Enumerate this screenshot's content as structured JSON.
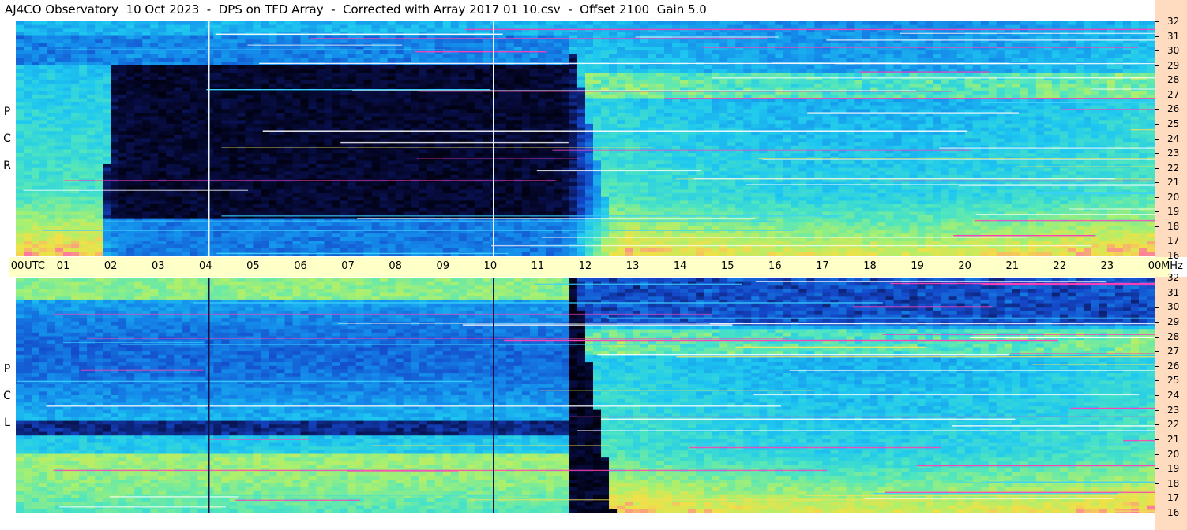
{
  "title": "AJ4CO Observatory  10 Oct 2023  -  DPS on TFD Array  -  Corrected with Array 2017 01 10.csv  -  Offset 2100  Gain 5.0",
  "chart_data": {
    "type": "heatmap",
    "title": "AJ4CO Observatory  10 Oct 2023  -  DPS on TFD Array  -  Corrected with Array 2017 01 10.csv  -  Offset 2100  Gain 5.0",
    "x": {
      "label": "UTC",
      "range": [
        0,
        24
      ],
      "tick_labels": [
        "00",
        "01",
        "02",
        "03",
        "04",
        "05",
        "06",
        "07",
        "08",
        "09",
        "10",
        "11",
        "12",
        "13",
        "14",
        "15",
        "16",
        "17",
        "18",
        "19",
        "20",
        "21",
        "22",
        "23",
        "00"
      ]
    },
    "y": {
      "label": "MHz",
      "range": [
        16,
        32
      ],
      "tick_labels": [
        "16",
        "17",
        "18",
        "19",
        "20",
        "21",
        "22",
        "23",
        "24",
        "25",
        "26",
        "27",
        "28",
        "29",
        "30",
        "31",
        "32"
      ]
    },
    "panels": [
      {
        "name": "R C P",
        "letters": [
          "R",
          "C",
          "P"
        ]
      },
      {
        "name": "L C P",
        "letters": [
          "L",
          "C",
          "P"
        ]
      }
    ],
    "colors": {
      "low": "#000010",
      "mid": "#1a7fe0",
      "high": "#ff3fb0",
      "max": "#ffffff"
    },
    "events": {
      "calibration_lines_utc": [
        4.07,
        10.07
      ],
      "dark_start_utc": 11.6,
      "dark_end_utc": 12.6
    }
  }
}
